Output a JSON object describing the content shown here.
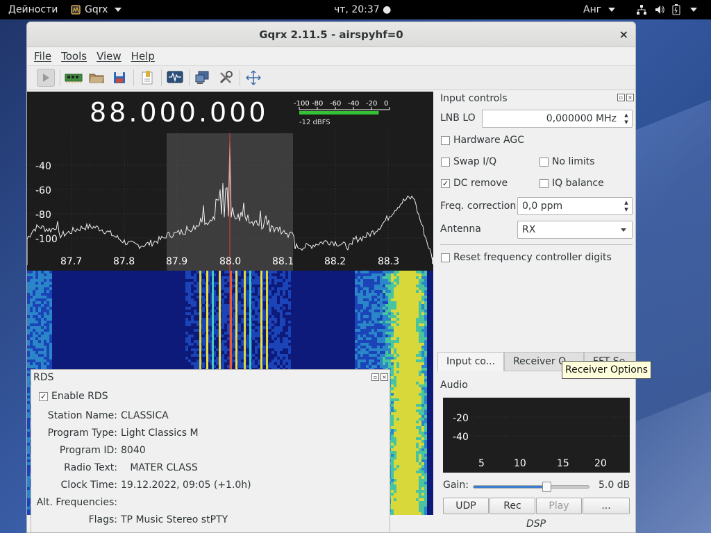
{
  "topbar": {
    "activities": "Дейности",
    "app_name": "Gqrx",
    "clock": "чт, 20:37 ●",
    "lang": "Анг"
  },
  "window": {
    "title": "Gqrx 2.11.5 - airspyhf=0",
    "close": "×"
  },
  "menu": [
    "File",
    "Tools",
    "View",
    "Help"
  ],
  "toolbar": {
    "icons": [
      "play-icon",
      "hardware-icon",
      "open-icon",
      "save-icon",
      "bookmark-icon",
      "scope-icon",
      "network-icon",
      "settings-icon",
      "fullscreen-icon"
    ]
  },
  "spectrum": {
    "frequency": "88.000.000",
    "meter_ticks": [
      "-100",
      "-80",
      "-60",
      "-40",
      "-20",
      "0"
    ],
    "meter_value": "-12 dBFS",
    "meter_level_db": -12,
    "y_labels": [
      "-40",
      "-60",
      "-80",
      "-100"
    ],
    "x_labels": [
      "87.7",
      "87.8",
      "87.9",
      "88.0",
      "88.1",
      "88.2",
      "88.3",
      "8"
    ]
  },
  "input_controls": {
    "title": "Input controls",
    "lnb_label": "LNB LO",
    "lnb_value": "0,000000 MHz",
    "hw_agc": "Hardware AGC",
    "hw_agc_checked": false,
    "swap_iq": "Swap I/Q",
    "swap_iq_checked": false,
    "no_limits": "No limits",
    "no_limits_checked": false,
    "dc_remove": "DC remove",
    "dc_remove_checked": true,
    "iq_balance": "IQ balance",
    "iq_balance_checked": false,
    "freq_corr_label": "Freq. correction",
    "freq_corr_value": "0,0 ppm",
    "antenna_label": "Antenna",
    "antenna_value": "RX",
    "reset_digits": "Reset frequency controller digits",
    "reset_checked": false
  },
  "tabs": [
    "Input co...",
    "Receiver O...",
    "FFT Se..."
  ],
  "audio": {
    "title": "Audio",
    "y_labels": [
      "-20",
      "-40"
    ],
    "x_labels": [
      "5",
      "10",
      "15",
      "20"
    ],
    "gain_label": "Gain:",
    "gain_value": "5.0 dB",
    "gain_fraction": 0.63,
    "buttons": [
      "UDP",
      "Rec",
      "Play",
      "..."
    ],
    "dsp_label": "DSP"
  },
  "tooltip": "Receiver Options",
  "rds": {
    "title": "RDS",
    "enable": "Enable RDS",
    "enable_checked": true,
    "rows": [
      {
        "label": "Station Name:",
        "value": "CLASSICA"
      },
      {
        "label": "Program Type:",
        "value": "Light Classics M"
      },
      {
        "label": "Program ID:",
        "value": "8040"
      },
      {
        "label": "Radio Text:",
        "value": "   MATER CLASS"
      },
      {
        "label": "Clock Time:",
        "value": "19.12.2022, 09:05 (+1.0h)"
      },
      {
        "label": "Alt. Frequencies:",
        "value": ""
      },
      {
        "label": "Flags:",
        "value": "TP Music Stereo stPTY"
      }
    ]
  },
  "colors": {
    "accent": "#3b7ed0",
    "spectrum_bg": "#1c1c1c",
    "meter_green": "#35c235",
    "center_line": "#e04040"
  }
}
